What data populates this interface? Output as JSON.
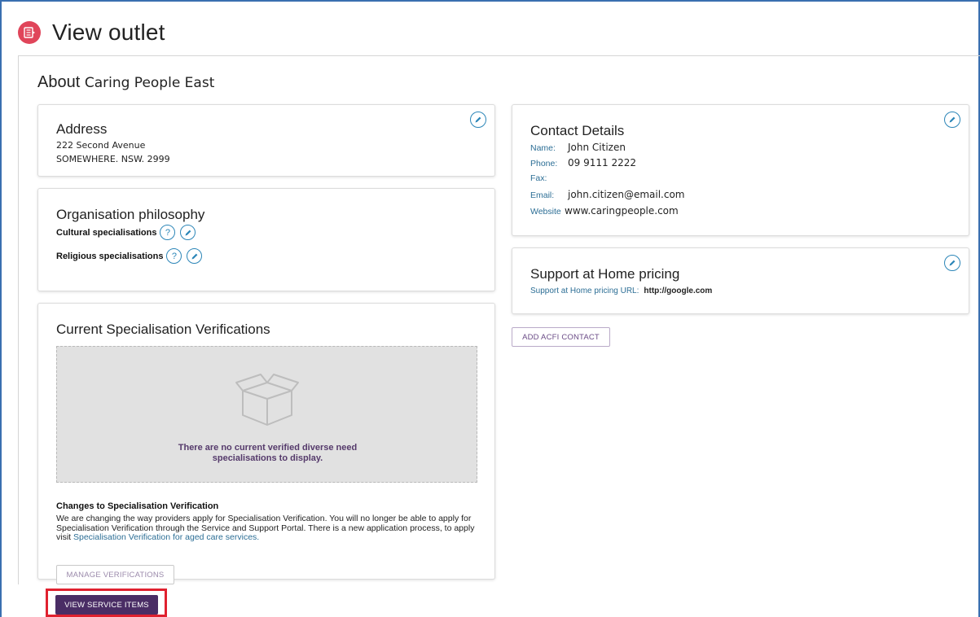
{
  "page": {
    "title": "View outlet",
    "about_prefix": "About",
    "outlet_name": "Caring People East"
  },
  "address": {
    "title": "Address",
    "line1": "222 Second Avenue",
    "line2": "SOMEWHERE. NSW. 2999"
  },
  "philosophy": {
    "title": "Organisation philosophy",
    "cultural_label": "Cultural specialisations",
    "religious_label": "Religious specialisations",
    "help_glyph": "?"
  },
  "verifications": {
    "title": "Current Specialisation Verifications",
    "empty_line1": "There are no current verified diverse need",
    "empty_line2": "specialisations to display.",
    "changes_title": "Changes to Specialisation Verification",
    "changes_body": "We are changing the way providers apply for Specialisation Verification. You will no longer be able to apply for Specialisation Verification through the Service and Support Portal. There is a new application process, to apply visit ",
    "changes_link": "Specialisation Verification for aged care services.",
    "manage_button": "MANAGE VERIFICATIONS"
  },
  "contact": {
    "title": "Contact Details",
    "name_label": "Name:",
    "name_value": "John Citizen",
    "phone_label": "Phone:",
    "phone_value": "09 9111 2222",
    "fax_label": "Fax:",
    "fax_value": "",
    "email_label": "Email:",
    "email_value": "john.citizen@email.com",
    "website_label": "Website",
    "website_value": "www.caringpeople.com"
  },
  "pricing": {
    "title": "Support at Home pricing",
    "url_label": "Support at Home pricing URL:",
    "url_value": "http://google.com"
  },
  "actions": {
    "add_acfi_contact": "ADD ACFI CONTACT",
    "view_service_items": "VIEW SERVICE ITEMS"
  },
  "colors": {
    "brand_purple": "#4a2d65",
    "link_blue": "#2c6e95",
    "icon_blue": "#2c86b8",
    "logo_red": "#e0455a",
    "highlight_red": "#e0212f"
  },
  "icons": {
    "logo": "outlet-logo-icon",
    "edit": "pencil-icon",
    "help": "question-icon",
    "empty": "open-box-icon"
  }
}
